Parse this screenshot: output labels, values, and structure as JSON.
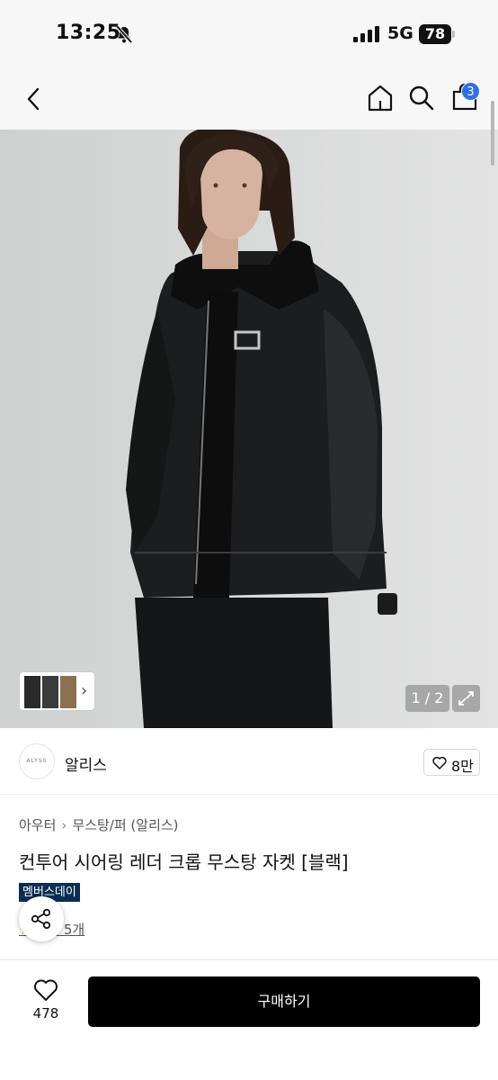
{
  "status_bar": {
    "time": "13:25",
    "network": "5G",
    "battery": "78"
  },
  "nav": {
    "cart_count": "3"
  },
  "gallery": {
    "counter": "1 / 2"
  },
  "brand": {
    "logo_text": "ALYSS",
    "name": "알리스",
    "likes": "8만"
  },
  "breadcrumb": {
    "category": "아우터",
    "subcategory": "무스탕/퍼 (알리스)"
  },
  "product": {
    "title": "컨투어 시어링 레더 크롭 무스탕 자켓 [블랙]",
    "badge": "멤버스데이",
    "review_link": "후기 5개"
  },
  "bottom_bar": {
    "wishlist_count": "478",
    "buy_label": "구매하기"
  },
  "colors": {
    "accent_blue": "#2f6fe4",
    "member_badge": "#0b2d52",
    "buy_button": "#000000"
  }
}
